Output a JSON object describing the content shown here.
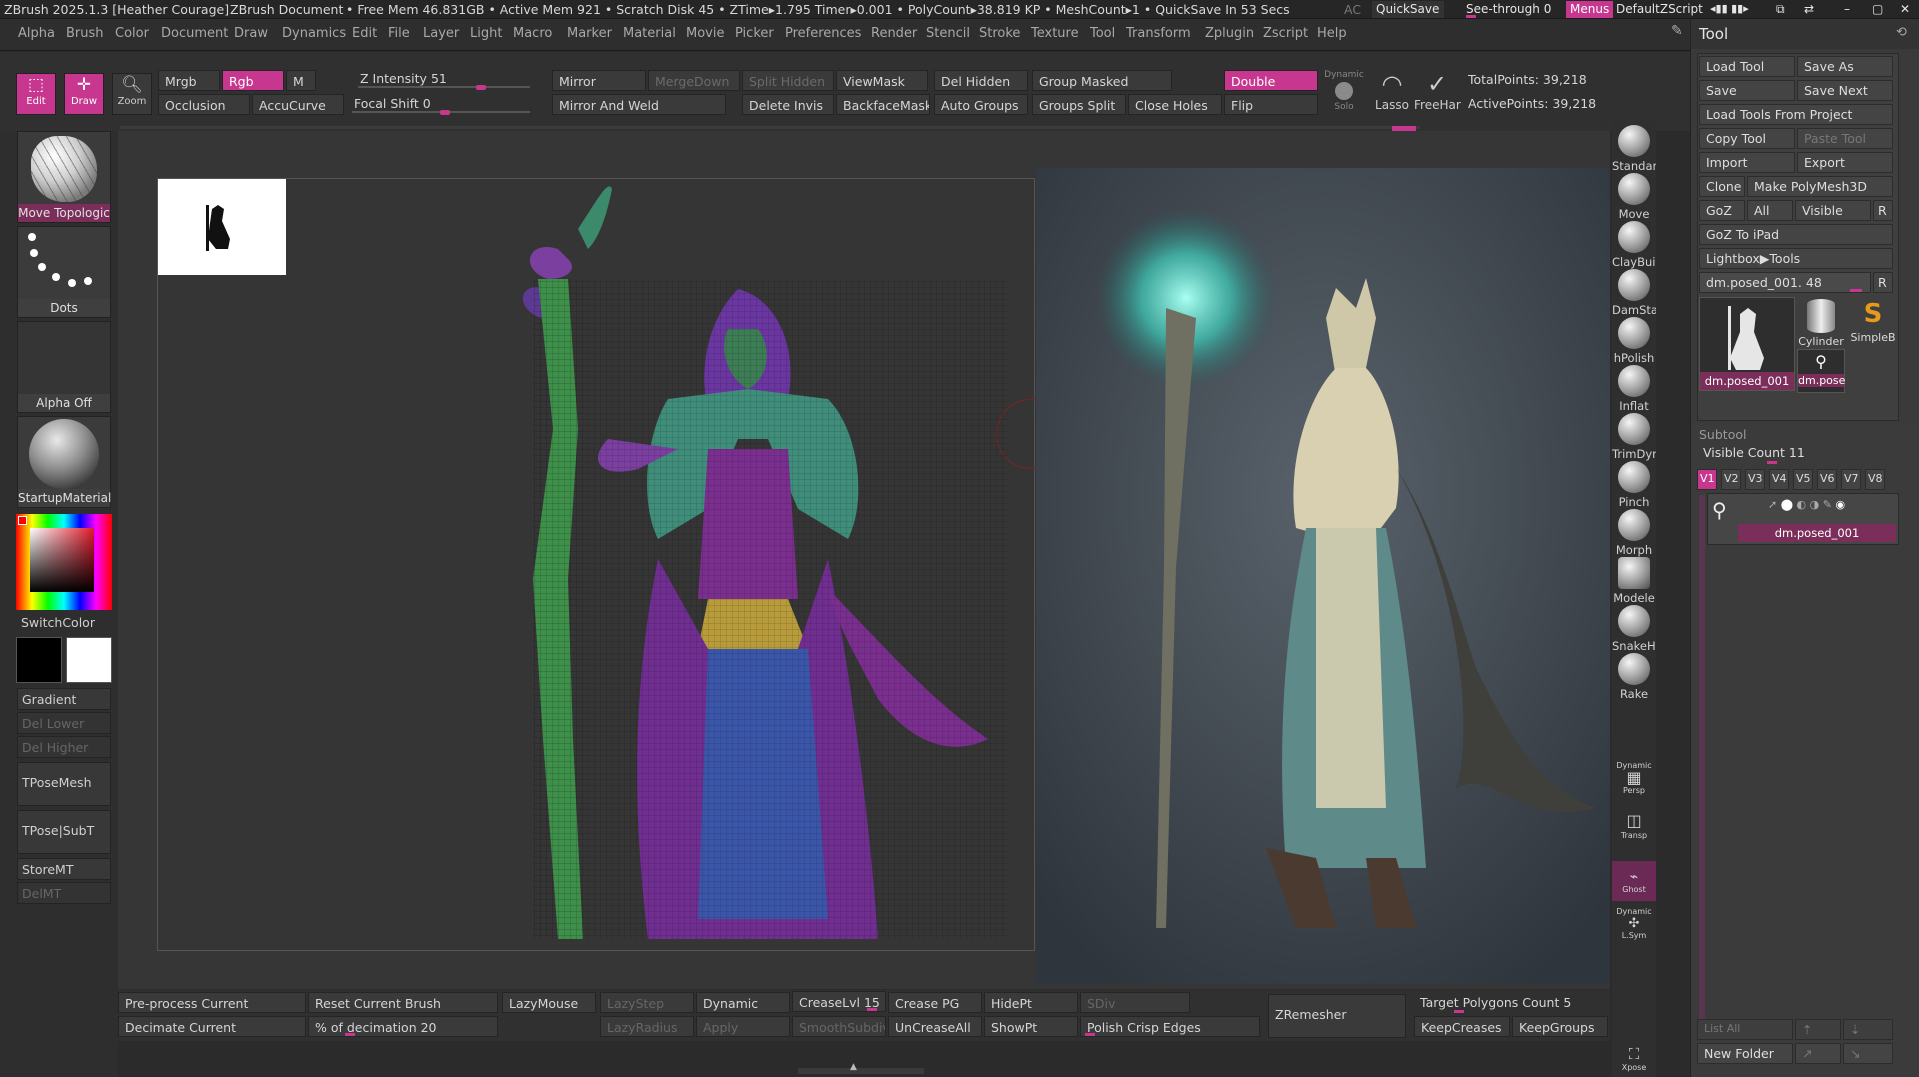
{
  "titlebar": {
    "app": "ZBrush 2025.1.3 [Heather Courage]",
    "doc": "ZBrush Document",
    "stats": "• Free Mem 46.831GB • Active Mem 921 • Scratch Disk 45 • ZTime▸1.795 Timer▸0.001 • PolyCount▸38.819 KP • MeshCount▸1 • QuickSave In 53 Secs",
    "ac": "AC",
    "quicksave": "QuickSave",
    "seethrough": "See-through",
    "seethrough_value": "0",
    "menus": "Menus",
    "script": "DefaultZScript"
  },
  "menubar": [
    "Alpha",
    "Brush",
    "Color",
    "Document",
    "Draw",
    "Dynamics",
    "Edit",
    "File",
    "Layer",
    "Light",
    "Macro",
    "Marker",
    "Material",
    "Movie",
    "Picker",
    "Preferences",
    "Render",
    "Stencil",
    "Stroke",
    "Texture",
    "Tool",
    "Transform",
    "Zplugin",
    "Zscript",
    "Help"
  ],
  "shelf": {
    "edit": "Edit",
    "draw": "Draw",
    "zoom": "Zoom",
    "mrgb": "Mrgb",
    "rgb": "Rgb",
    "m": "M",
    "occlusion": "Occlusion",
    "accucurve": "AccuCurve",
    "z_intensity_label": "Z Intensity",
    "z_intensity": "51",
    "focal_shift_label": "Focal Shift",
    "focal_shift": "0",
    "mirror": "Mirror",
    "mergedown": "MergeDown",
    "split_hidden": "Split Hidden",
    "viewmask": "ViewMask",
    "del_hidden": "Del Hidden",
    "group_masked": "Group Masked",
    "double": "Double",
    "dynamic": "Dynamic",
    "solo": "Solo",
    "lasso": "Lasso",
    "freehand": "FreeHar",
    "mirror_weld": "Mirror And Weld",
    "delete_invis": "Delete Invis",
    "backfacemask": "BackfaceMask",
    "auto_groups": "Auto Groups",
    "groups_split": "Groups Split",
    "close_holes": "Close Holes",
    "flip": "Flip",
    "total_points": "TotalPoints: 39,218",
    "active_points": "ActivePoints: 39,218"
  },
  "leftpanel": {
    "brush": "Move Topologic",
    "stroke": "Dots",
    "alpha": "Alpha Off",
    "material": "StartupMaterial",
    "switchcolor": "SwitchColor",
    "gradient": "Gradient",
    "del_lower": "Del Lower",
    "del_higher": "Del Higher",
    "tposemesh": "TPoseMesh",
    "tpose_subt": "TPose|SubT",
    "storemt": "StoreMT",
    "delmt": "DelMT"
  },
  "rightshelf": [
    "Standar",
    "Move",
    "ClayBuil",
    "DamSta",
    "hPolish",
    "Inflat",
    "TrimDyr",
    "Pinch",
    "Morph",
    "Modele",
    "SnakeHo",
    "Rake"
  ],
  "rightshelf_bottom": {
    "dynamic": "Dynamic",
    "persp": "Persp",
    "transp": "Transp",
    "ghost": "Ghost",
    "lsym": "L.Sym",
    "xpose": "Xpose"
  },
  "tool": {
    "title": "Tool",
    "load_tool": "Load Tool",
    "save_as": "Save As",
    "save": "Save",
    "save_next": "Save Next",
    "load_from_project": "Load Tools From Project",
    "copy_tool": "Copy Tool",
    "paste_tool": "Paste Tool",
    "import": "Import",
    "export": "Export",
    "clone": "Clone",
    "make_polymesh": "Make PolyMesh3D",
    "goz": "GoZ",
    "all": "All",
    "visible": "Visible",
    "r": "R",
    "goz_ipad": "GoZ To iPad",
    "lightbox": "Lightbox▶Tools",
    "current_tool": "dm.posed_001. 48",
    "r2": "R",
    "thumbs": [
      "dm.posed_001",
      "Cylinder",
      "SimpleB",
      "dm.pose"
    ]
  },
  "subtool": {
    "title": "Subtool",
    "visible_count_label": "Visible Count",
    "visible_count": "11",
    "versions": [
      "V1",
      "V2",
      "V3",
      "V4",
      "V5",
      "V6",
      "V7",
      "V8"
    ],
    "item_name": "dm.posed_001",
    "list_all": "List All",
    "new_folder": "New Folder"
  },
  "bottombar": {
    "preprocess": "Pre-process Current",
    "reset_brush": "Reset Current Brush",
    "lazymouse": "LazyMouse",
    "lazystep": "LazyStep",
    "dynamic": "Dynamic",
    "creaselvl_label": "CreaseLvl",
    "creaselvl": "15",
    "crease_pg": "Crease PG",
    "hidept": "HidePt",
    "sdiv": "SDiv",
    "zremesher": "ZRemesher",
    "target_poly_label": "Target Polygons Count",
    "target_poly": "5",
    "decimate": "Decimate Current",
    "decimation_label": "% of decimation",
    "decimation": "20",
    "lazyradius": "LazyRadius",
    "apply": "Apply",
    "smoothsubdiv": "SmoothSubdiv",
    "uncreaseall": "UnCreaseAll",
    "showpt": "ShowPt",
    "polish_crisp": "Polish Crisp Edges",
    "keepcreases": "KeepCreases",
    "keepgroups": "KeepGroups"
  },
  "colors": {
    "accent": "#c8378f",
    "background": "#2b2b2b",
    "panel": "#3a3a3a"
  }
}
